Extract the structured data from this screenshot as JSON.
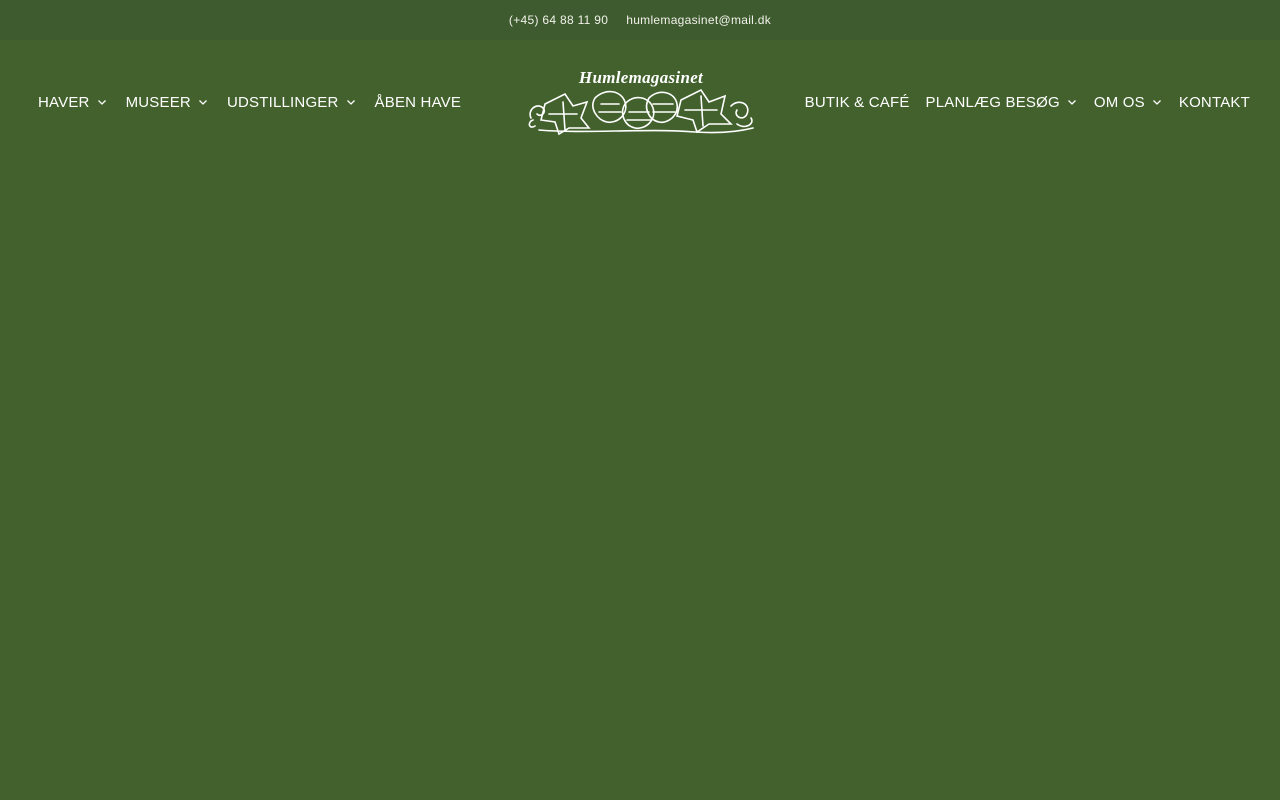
{
  "topbar": {
    "phone": "(+45) 64 88 11 90",
    "email": "humlemagasinet@mail.dk"
  },
  "logo": {
    "text": "Humlemagasinet"
  },
  "nav_left": [
    {
      "label": "HAVER",
      "has_dropdown": true
    },
    {
      "label": "MUSEER",
      "has_dropdown": true
    },
    {
      "label": "UDSTILLINGER",
      "has_dropdown": true
    },
    {
      "label": "ÅBEN HAVE",
      "has_dropdown": false
    }
  ],
  "nav_right": [
    {
      "label": "BUTIK & CAFÉ",
      "has_dropdown": false
    },
    {
      "label": "PLANLÆG BESØG",
      "has_dropdown": true
    },
    {
      "label": "OM OS",
      "has_dropdown": true
    },
    {
      "label": "KONTAKT",
      "has_dropdown": false
    }
  ],
  "colors": {
    "background": "#42612d",
    "topbar": "#3e5a2f",
    "text": "#ffffff"
  },
  "icons": {
    "dropdown": "chevron-down-icon",
    "logo_art": "hop-vine-icon"
  }
}
